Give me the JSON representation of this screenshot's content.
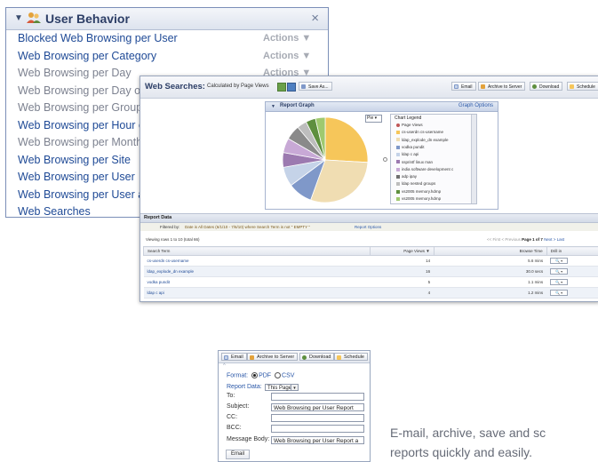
{
  "left_panel": {
    "title": "User Behavior",
    "close_glyph": "×",
    "items": [
      {
        "label": "Blocked Web Browsing per User",
        "style": "link",
        "actions": "Actions ▼"
      },
      {
        "label": "Web Browsing per Category",
        "style": "link",
        "actions": "Actions ▼"
      },
      {
        "label": "Web Browsing per Day",
        "style": "dim",
        "actions": "Actions ▼"
      },
      {
        "label": "Web Browsing per Day of W",
        "style": "dim",
        "actions": ""
      },
      {
        "label": "Web Browsing per Group",
        "style": "dim",
        "actions": ""
      },
      {
        "label": "Web Browsing per Hour of",
        "style": "link",
        "actions": ""
      },
      {
        "label": "Web Browsing per Month",
        "style": "dim",
        "actions": ""
      },
      {
        "label": "Web Browsing per Site",
        "style": "link",
        "actions": ""
      },
      {
        "label": "Web Browsing per User",
        "style": "link",
        "actions": ""
      },
      {
        "label": "Web Browsing per User ar",
        "style": "link",
        "actions": ""
      },
      {
        "label": "Web Searches",
        "style": "link",
        "actions": ""
      }
    ]
  },
  "report": {
    "title": "Web Searches:",
    "calculated_by": "Calculated by Page Views",
    "save_as": "Save As...",
    "toolbar": {
      "email": "Email",
      "archive": "Archive to Server",
      "download": "Download",
      "schedule": "Schedule"
    },
    "graph": {
      "title": "Report Graph",
      "options": "Graph Options",
      "chart_type_select": "Pie",
      "legend_title": "Chart Legend",
      "legend_items": [
        {
          "label": "Page Views",
          "color": "#c05656"
        },
        {
          "label": "cs-userdn cs-username",
          "color": "#f6c65a"
        },
        {
          "label": "ldap_explode_dn example",
          "color": "#f0ddb2"
        },
        {
          "label": "vodka pundit",
          "color": "#7f98c9"
        },
        {
          "label": "ldap c api",
          "color": "#c5d3e8"
        },
        {
          "label": "ssprintf linux man",
          "color": "#9c7ab0"
        },
        {
          "label": "india software development c",
          "color": "#c8a9d6"
        },
        {
          "label": "adp ipay",
          "color": "#6f6f6f"
        },
        {
          "label": "ldap nested groups",
          "color": "#bdbdbd"
        },
        {
          "label": "vs2005 memory.hdmp",
          "color": "#5e8f3e"
        },
        {
          "label": "vs2005 memory.hdmp",
          "color": "#9fc96f"
        }
      ],
      "slices": [
        {
          "value": 14,
          "color": "#f6c65a"
        },
        {
          "value": 16,
          "color": "#f0ddb2"
        },
        {
          "value": 5,
          "color": "#7f98c9"
        },
        {
          "value": 4,
          "color": "#c5d3e8"
        },
        {
          "value": 3,
          "color": "#9c7ab0"
        },
        {
          "value": 3,
          "color": "#c8a9d6"
        },
        {
          "value": 3,
          "color": "#8a8a8a"
        },
        {
          "value": 2,
          "color": "#bdbdbd"
        },
        {
          "value": 2,
          "color": "#5e8f3e"
        },
        {
          "value": 2,
          "color": "#9fc96f"
        }
      ]
    },
    "data": {
      "header": "Report Data",
      "filter_label": "Filtered by:",
      "filter_value": "Date is All Dates (6/1/10 - 7/6/10) where Search Term is not \" EMPTY \"",
      "report_options": "Report Options",
      "viewing": "Viewing rows 1 to 10 (total 66)",
      "pager_prev": "<< First  < Previous",
      "pager_page": "Page 1 of 7",
      "pager_next": "Next >  Last",
      "columns": {
        "term": "Search Term",
        "views": "Page Views ▼",
        "time": "Browse Time",
        "drill": "Drill in"
      },
      "drill_glyph": "🔍 ▾",
      "rows": [
        {
          "term": "cs-userdn cs-username",
          "views": "14",
          "time": "5.6 mins"
        },
        {
          "term": "ldap_explode_dn example",
          "views": "16",
          "time": "30.0 secs"
        },
        {
          "term": "vodka pundit",
          "views": "5",
          "time": "1.1 mins"
        },
        {
          "term": "ldap c api",
          "views": "4",
          "time": "1.2 mins"
        }
      ]
    }
  },
  "dialog": {
    "toolbar": {
      "email": "Email",
      "archive": "Archive to Server",
      "download": "Download",
      "schedule": "Schedule"
    },
    "format_label": "Format:",
    "format_pdf": "PDF",
    "format_csv": "CSV",
    "report_data_label": "Report Data:",
    "report_data_value": "This Page",
    "to_label": "To:",
    "to_value": "",
    "subject_label": "Subject:",
    "subject_value": "Web Browsing per User Report",
    "cc_label": "CC:",
    "cc_value": "",
    "bcc_label": "BCC:",
    "bcc_value": "",
    "message_label": "Message Body:",
    "message_value": "Web Browsing per User Report a",
    "send_label": "Email"
  },
  "tagline": {
    "line1": "E-mail, archive, save and sc",
    "line2": "reports quickly and easily."
  }
}
